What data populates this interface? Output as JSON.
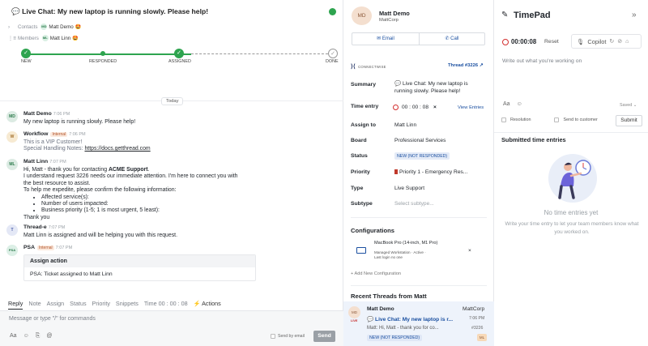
{
  "ticket": {
    "title": "💬 Live Chat: My new laptop is running slowly. Please help!",
    "contacts_label": "Contacts",
    "contact": "Matt Demo",
    "contact_initials": "MD",
    "members_label": "Members",
    "member": "Matt Linn",
    "member_initials": "ML",
    "stages": [
      "NEW",
      "RESPONDED",
      "ASSIGNED",
      "DONE"
    ],
    "today_label": "Today"
  },
  "messages": [
    {
      "initials": "MD",
      "author": "Matt Demo",
      "time": "7:06 PM",
      "lines": [
        "My new laptop is running slowly. Please help!"
      ]
    },
    {
      "initials": "W",
      "author": "Workflow",
      "tag": "Internal",
      "time": "7:06 PM",
      "line1": "This is a VIP Customer!",
      "line2_prefix": "Special Handling Notes: ",
      "line2_link": "https://docs.getthread.com"
    },
    {
      "initials": "ML",
      "author": "Matt Linn",
      "time": "7:07 PM",
      "intro_prefix": "Hi, Matt - thank you for contacting ",
      "intro_bold": "ACME Support",
      "intro_suffix": ".",
      "l2": "I understand request 3226 needs our immediate attention. I'm here to connect you with",
      "l3": "the best resource to assist.",
      "l4": "To help me expedite, please confirm the following information:",
      "bullets": [
        "Affected service(s):",
        "Number of users impacted:",
        "Business priority (1-5; 1 is most urgent, 5 least):"
      ],
      "l5": "Thank you"
    },
    {
      "initials": "T",
      "author": "Thread-e",
      "time": "7:07 PM",
      "lines": [
        "Matt Linn is assigned and will be helping you with this request."
      ]
    },
    {
      "initials": "PSA",
      "author": "PSA",
      "tag": "Internal",
      "time": "7:07 PM",
      "box_title": "Assign action",
      "box_text": "PSA: Ticket assigned to Matt Linn"
    }
  ],
  "composer": {
    "tabs": [
      "Reply",
      "Note",
      "Assign",
      "Status",
      "Priority",
      "Snippets",
      "Time 00 : 00 : 08",
      "⚡ Actions"
    ],
    "placeholder": "Message or type \"/\" for commands",
    "send_by_email": "Send by email",
    "send": "Send"
  },
  "contact_panel": {
    "initials": "MD",
    "name": "Matt Demo",
    "org": "MattCorp",
    "email_btn": "Email",
    "call_btn": "Call",
    "logo_text": "CONNECTWISE",
    "thread_no": "Thread #3226",
    "fields": {
      "summary_label": "Summary",
      "summary_l1": "💬 Live Chat: My new laptop is",
      "summary_l2": "running slowly. Please help!",
      "time_entry_label": "Time entry",
      "time_entry_value": "00 : 00 : 08",
      "view_entries": "View Entries",
      "assign_label": "Assign to",
      "assign_value": "Matt Linn",
      "board_label": "Board",
      "board_value": "Professional Services",
      "status_label": "Status",
      "status_value": "NEW (NOT RESPONDED)",
      "priority_label": "Priority",
      "priority_value": "Priority 1 - Emergency Res...",
      "type_label": "Type",
      "type_value": "Live Support",
      "subtype_label": "Subtype",
      "subtype_placeholder": "Select subtype..."
    },
    "configurations_title": "Configurations",
    "config": {
      "name": "MacBook Pro (14-inch, M1 Pro)",
      "sub1": "Managed Workstation · Active ·",
      "sub2": "Last login no one"
    },
    "add_config": "+ Add New Configuration",
    "recent_title": "Recent Threads from Matt",
    "recent": {
      "initials": "MD",
      "live": "LIVE",
      "name": "Matt Demo",
      "org": "MattCorp",
      "title": "💬 Live Chat: My new laptop is r...",
      "time": "7:06 PM",
      "snippet": "Matt: Hi, Matt - thank you for co...",
      "thread": "#3226",
      "status": "NEW (NOT RESPONDED)",
      "assignee_initials": "ML"
    }
  },
  "timepad": {
    "title": "TimePad",
    "timer": "00:00:08",
    "reset": "Reset",
    "copilot": "Copilot",
    "placeholder": "Write out what you're working on",
    "saved": "Saved",
    "resolution": "Resolution",
    "send_to_customer": "Send to customer",
    "submit": "Submit",
    "submitted_title": "Submitted time entries",
    "empty_title": "No time entries yet",
    "empty_desc": "Write your time entry to let your team members know what you worked on."
  },
  "colors": {
    "accent_green": "#2ea44f",
    "link_blue": "#1a4fa0",
    "internal_tag": "#b2542b"
  }
}
